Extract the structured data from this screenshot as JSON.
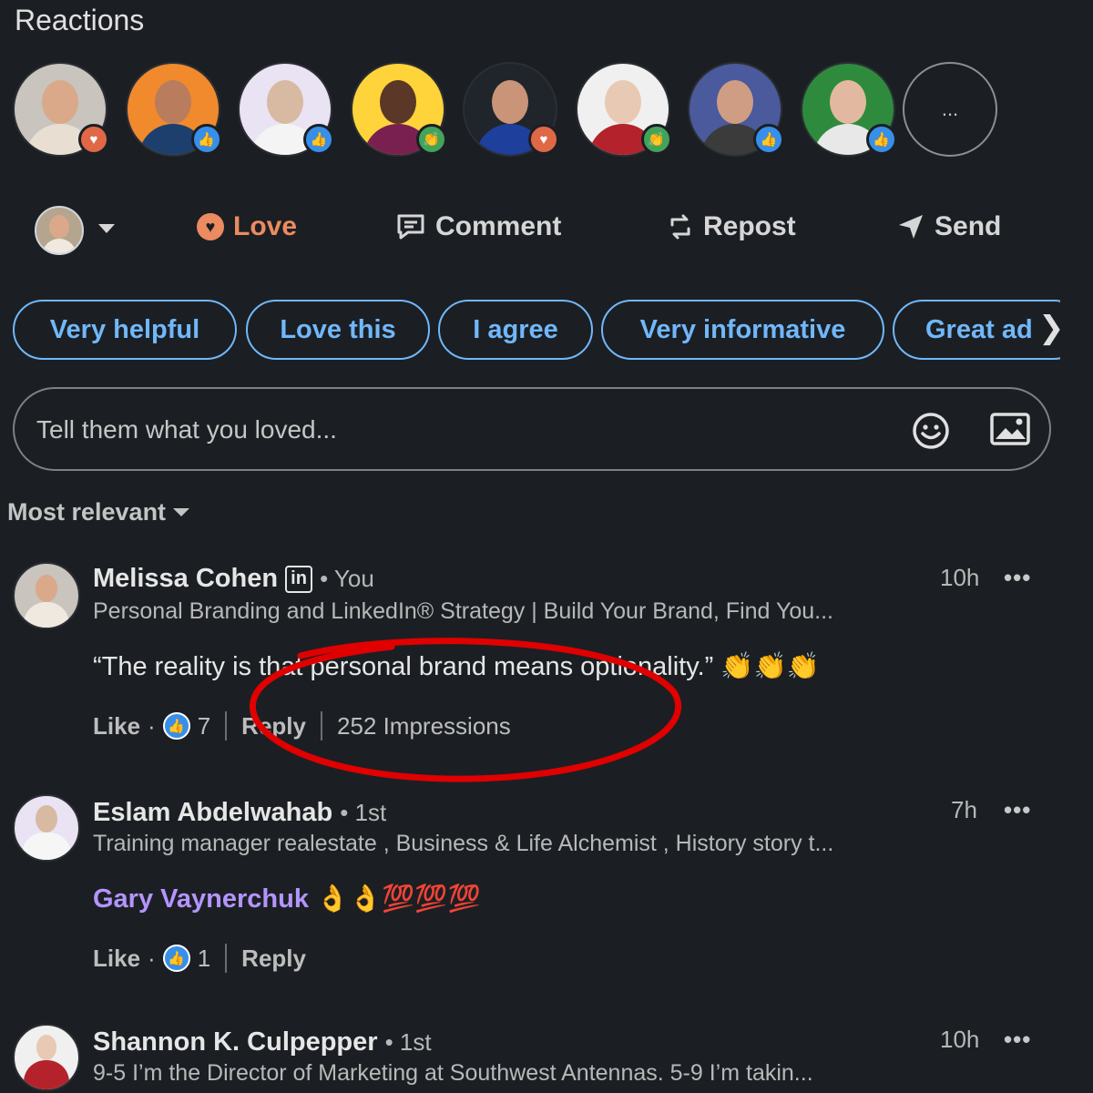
{
  "header": {
    "title": "Reactions"
  },
  "reactors": [
    {
      "badge": "love",
      "skin": "#d9a98a",
      "shirt": "#e8dfd2",
      "bg": "#c9c4bd"
    },
    {
      "badge": "like",
      "skin": "#b97c5c",
      "shirt": "#1d3f6e",
      "bg": "#f08a2d"
    },
    {
      "badge": "like",
      "skin": "#d8b9a2",
      "shirt": "#f4f4f4",
      "bg": "#e9e3f3"
    },
    {
      "badge": "clap",
      "skin": "#5b3727",
      "shirt": "#7a2050",
      "bg": "#ffd43b"
    },
    {
      "badge": "love",
      "skin": "#c99478",
      "shirt": "#1f3f9c",
      "bg": "#20252b"
    },
    {
      "badge": "clap",
      "skin": "#e8c9b4",
      "shirt": "#b4232b",
      "bg": "#f0f0f0"
    },
    {
      "badge": "like",
      "skin": "#cf9d84",
      "shirt": "#3b3b3b",
      "bg": "#4a5a9c"
    },
    {
      "badge": "like",
      "skin": "#e2b9a0",
      "shirt": "#e8e8e8",
      "bg": "#2e8b3e"
    }
  ],
  "more_reactors_label": "...",
  "actions": {
    "love": "Love",
    "comment": "Comment",
    "repost": "Repost",
    "send": "Send"
  },
  "chips": [
    "Very helpful",
    "Love this",
    "I agree",
    "Very informative",
    "Great ad"
  ],
  "composer": {
    "placeholder": "Tell them what you loved..."
  },
  "sort": {
    "label": "Most relevant"
  },
  "comments": [
    {
      "name": "Melissa Cohen",
      "degree": "• You",
      "headline": "Personal Branding and LinkedIn® Strategy | Build Your Brand, Find You...",
      "text": "“The reality is that personal brand means optionality.” 👏👏👏",
      "time": "10h",
      "like_label": "Like",
      "like_count": "7",
      "reply_label": "Reply",
      "impressions": "252 Impressions"
    },
    {
      "name": "Eslam Abdelwahab",
      "degree": "• 1st",
      "headline": "Training manager realestate , Business & Life Alchemist , History story t...",
      "mention": "Gary Vaynerchuk",
      "text": "👌👌💯💯💯",
      "time": "7h",
      "like_label": "Like",
      "like_count": "1",
      "reply_label": "Reply"
    },
    {
      "name": "Shannon K. Culpepper",
      "degree": "• 1st",
      "headline": "9-5 I’m the Director of Marketing at Southwest Antennas. 5-9 I’m takin...",
      "time": "10h"
    }
  ],
  "more_menu_label": "•••",
  "colors": {
    "accent": "#71b7fb",
    "love": "#e06847",
    "like": "#378fe9",
    "annotation": "#e00000",
    "mention": "#b494ff"
  }
}
